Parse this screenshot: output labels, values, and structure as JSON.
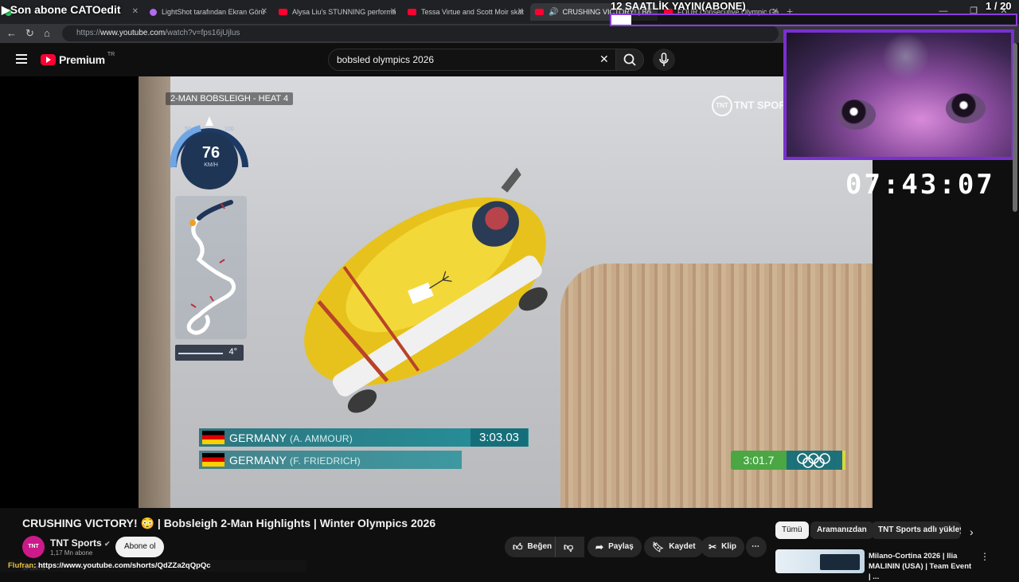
{
  "browser": {
    "tabs": [
      {
        "label": "",
        "icon": "whatsapp-icon"
      },
      {
        "label": "LightShot tarafından Ekran Görünt",
        "icon": "lightshot-icon"
      },
      {
        "label": "Alysa Liu's STUNNING performanc",
        "icon": "youtube-icon"
      },
      {
        "label": "Tessa Virtue and Scott Moir skate",
        "icon": "youtube-icon"
      },
      {
        "label": "CRUSHING VICTORY! | Bo",
        "icon": "youtube-icon",
        "active": true
      },
      {
        "label": "FOUR Consecutive Olympic Golds",
        "icon": "youtube-icon"
      }
    ],
    "url_prefix": "https://",
    "url_host": "www.youtube.com",
    "url_path": "/watch?v=fps16jUjlus"
  },
  "youtube": {
    "brand": "Premium",
    "region": "TR",
    "search_value": "bobsled olympics 2026"
  },
  "video_overlay": {
    "heat_label": "2-MAN BOBSLEIGH - HEAT 4",
    "broadcaster": "TNT SPORTS",
    "broadcaster_badge": "TNT",
    "speed": "76",
    "speed_unit": "KM/H",
    "speed_ticks": [
      "50",
      "100"
    ],
    "grade": "4°",
    "results": [
      {
        "country": "GERMANY",
        "athlete": "(A. AMMOUR)",
        "time": "3:03.03"
      },
      {
        "country": "GERMANY",
        "athlete": "(F. FRIEDRICH)",
        "time": ""
      }
    ],
    "split_time": "3:01.7"
  },
  "stream_overlay": {
    "last_sub": "Son abone CATOedit",
    "goal_title": "12 SAATLİK YAYIN(ABONE)",
    "goal_count": "1 / 20",
    "goal_progress": 0.05,
    "timer": "07:43:07",
    "chat_user": "Flufran",
    "chat_message": ": https://www.youtube.com/shorts/QdZZa2qQpQc"
  },
  "video": {
    "title": "CRUSHING VICTORY! 😳 | Bobsleigh 2-Man Highlights | Winter Olympics 2026",
    "channel": "TNT Sports",
    "channel_avatar": "TNT SPORTS",
    "subscribers": "1,17 Mn abone",
    "subscribe_label": "Abone ol",
    "actions": {
      "like": "Beğen",
      "share": "Paylaş",
      "save": "Kaydet",
      "clip": "Klip"
    }
  },
  "sidebar": {
    "chips": [
      "Tümü",
      "Aramanızdan",
      "TNT Sports adlı yükleyic"
    ],
    "rec_title": "Milano-Cortina 2026 | Ilia MALININ (USA) | Team Event | ..."
  },
  "colors": {
    "youtube_red": "#ff0033",
    "stream_purple": "#7a2fd0",
    "split_green": "#4aa744",
    "overlay_teal": "#148c96"
  }
}
